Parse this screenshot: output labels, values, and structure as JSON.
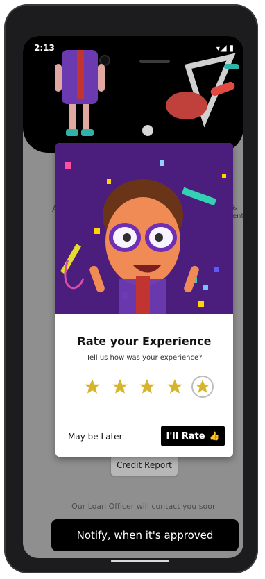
{
  "status_bar": {
    "time": "2:13",
    "right_icons": "▾◢ ▮"
  },
  "background": {
    "left_partial_text": "A",
    "right_partial_text": "&\nent",
    "credit_report_label": "Credit Report",
    "loan_officer_text": "Our Loan Officer will contact you soon",
    "notify_button_label": "Notify, when it's approved"
  },
  "modal": {
    "title": "Rate your Experience",
    "subtitle": "Tell us how was your experience?",
    "rating": {
      "value": 5,
      "max": 5
    },
    "later_label": "May be Later",
    "rate_label": "I'll Rate",
    "accent_color": "#d7b52a",
    "hero_background": "#4b1d7d"
  }
}
